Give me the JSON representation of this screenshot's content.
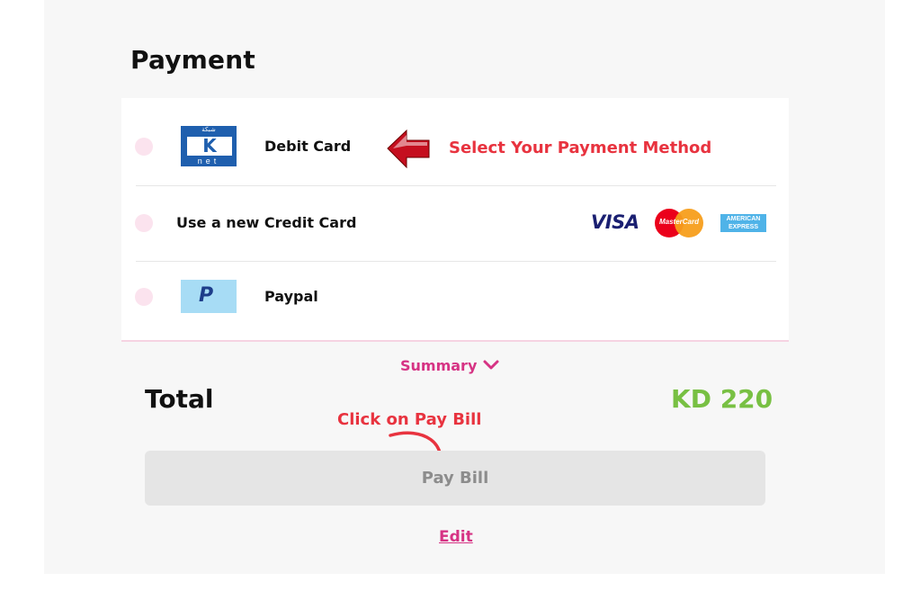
{
  "page": {
    "title": "Payment"
  },
  "payment_methods": [
    {
      "label": "Debit Card",
      "logo": "knet-logo",
      "selected": false
    },
    {
      "label": "Use a new Credit Card",
      "logos": [
        "visa-logo",
        "mastercard-logo",
        "amex-logo"
      ],
      "selected": false
    },
    {
      "label": "Paypal",
      "logo": "paypal-logo",
      "selected": false
    }
  ],
  "logos": {
    "knet_top": "شبكة",
    "knet_letter": "K",
    "knet_bottom": "net",
    "visa": "VISA",
    "mastercard": "MasterCard",
    "amex_top": "AMERICAN",
    "amex_bottom": "EXPRESS",
    "paypal": "P"
  },
  "annotations": {
    "select_method": "Select Your Payment Method",
    "click_pay": "Click on Pay Bill"
  },
  "summary": {
    "label": "Summary",
    "icon": "chevron-down-icon"
  },
  "total": {
    "label": "Total",
    "value": "KD 220"
  },
  "actions": {
    "pay_bill": "Pay Bill",
    "edit": "Edit"
  },
  "colors": {
    "accent": "#d63384",
    "radio": "#fbe3ee",
    "total_value": "#78c043",
    "annotation": "#e8333f",
    "button_bg": "#e5e5e5",
    "button_text": "#8c8c8c"
  }
}
